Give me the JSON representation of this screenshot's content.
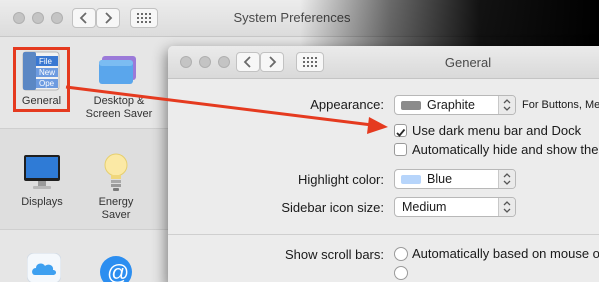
{
  "background_window": {
    "title": "System Preferences",
    "preferences": [
      {
        "label_lines": [
          "General"
        ],
        "icon": "general-icon"
      },
      {
        "label_lines": [
          "Desktop &",
          "Screen Saver"
        ],
        "icon": "desktop-screensaver-icon"
      },
      {
        "label_lines": [
          "Displays"
        ],
        "icon": "display-icon"
      },
      {
        "label_lines": [
          "Energy",
          "Saver"
        ],
        "icon": "lightbulb-icon"
      }
    ],
    "general_icon_texts": [
      "File",
      "New",
      "Ope"
    ],
    "bottom_row_icons": [
      "icloud-icon",
      "internet-accounts-icon",
      "app-store-icon",
      "network-icon"
    ]
  },
  "general_window": {
    "title": "General",
    "appearance": {
      "label": "Appearance:",
      "value": "Graphite",
      "note": "For Buttons, Men"
    },
    "dark_menu_bar": {
      "label": "Use dark menu bar and Dock",
      "checked": true
    },
    "auto_hide": {
      "label": "Automatically hide and show the me",
      "checked": false
    },
    "highlight_color": {
      "label": "Highlight color:",
      "value": "Blue",
      "swatch": "#b7d5fb"
    },
    "sidebar_icon_size": {
      "label": "Sidebar icon size:",
      "value": "Medium"
    },
    "scroll_bars": {
      "label": "Show scroll bars:",
      "option": "Automatically based on mouse or t"
    }
  },
  "colors": {
    "annotation": "#e53a1f",
    "graphite_swatch": "#8b8b8b"
  }
}
